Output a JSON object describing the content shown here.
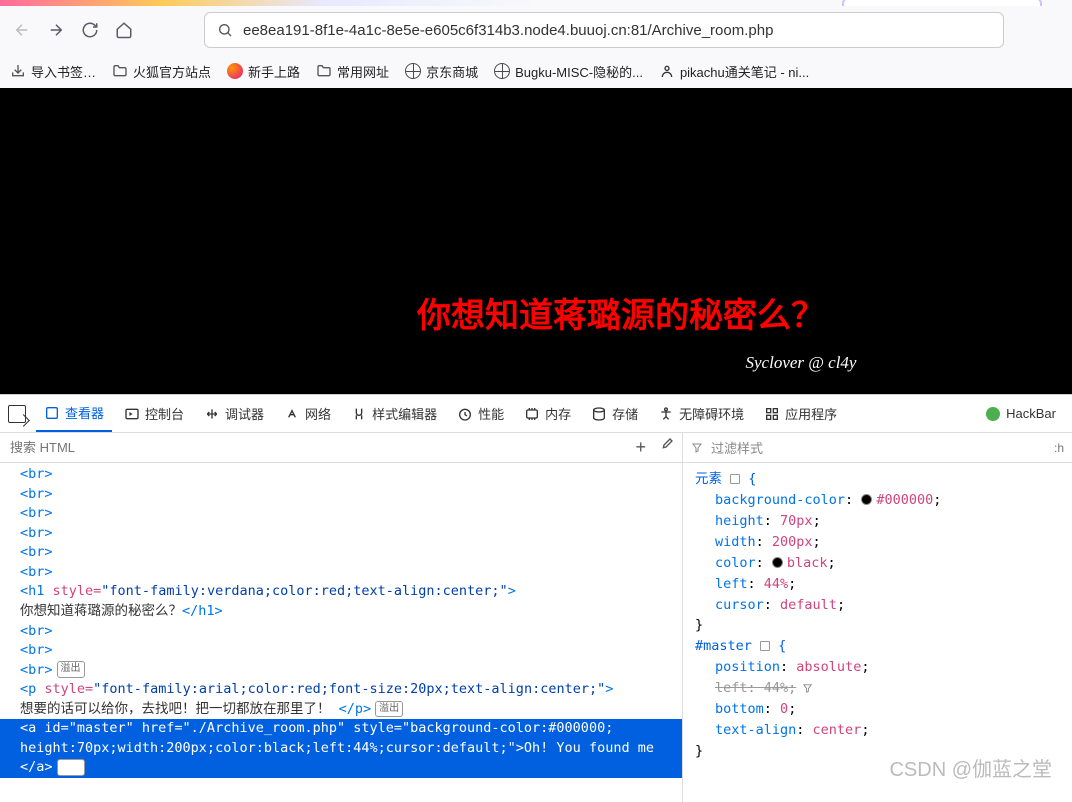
{
  "nav": {
    "url": "ee8ea191-8f1e-4a1c-8e5e-e605c6f314b3.node4.buuoj.cn:81/Archive_room.php"
  },
  "bookmarks": {
    "import": "导入书签…",
    "items": [
      {
        "label": "火狐官方站点",
        "icon": "folder"
      },
      {
        "label": "新手上路",
        "icon": "firefox"
      },
      {
        "label": "常用网址",
        "icon": "folder"
      },
      {
        "label": "京东商城",
        "icon": "globe"
      },
      {
        "label": "Bugku-MISC-隐秘的...",
        "icon": "globe"
      },
      {
        "label": "pikachu通关笔记 - ni...",
        "icon": "person"
      }
    ]
  },
  "page": {
    "headline": "你想知道蒋璐源的秘密么？",
    "signature": "Syclover @ cl4y"
  },
  "devtools": {
    "tabs": [
      "查看器",
      "控制台",
      "调试器",
      "网络",
      "样式编辑器",
      "性能",
      "内存",
      "存储",
      "无障碍环境",
      "应用程序"
    ],
    "hackbar": "HackBar",
    "search_ph": "搜索 HTML",
    "plus": "+",
    "dropper": "🖉",
    "filter_ph": "过滤样式",
    "hov": ":h",
    "badge": "溢出"
  },
  "markup": {
    "br": "<br>",
    "h1_open": "<h1 ",
    "h1_style_k": "style",
    "h1_style_v": "\"font-family:verdana;color:red;text-align:center;\"",
    "h1_close": ">",
    "h1_text": "你想知道蒋璐源的秘密么？",
    "h1_end": "</h1>",
    "p_open": "<p ",
    "p_style_v": "\"font-family:arial;color:red;font-size:20px;text-align:center;\"",
    "p_close": ">",
    "p_text": "想要的话可以给你，去找吧！把一切都放在那里了！",
    "p_end": "</p>",
    "a_line1": "<a id=\"master\" href=\"./Archive_room.php\" style=\"background-color:#000000;",
    "a_line2": "height:70px;width:200px;color:black;left:44%;cursor:default;\">Oh! You found me",
    "a_line3": "</a>"
  },
  "styles": {
    "r1": {
      "sel": "元素",
      "decl": [
        {
          "p": "background-color",
          "v": "#000000",
          "sw": "#000"
        },
        {
          "p": "height",
          "v": "70px"
        },
        {
          "p": "width",
          "v": "200px"
        },
        {
          "p": "color",
          "v": "black",
          "sw": "#000"
        },
        {
          "p": "left",
          "v": "44%"
        },
        {
          "p": "cursor",
          "v": "default"
        }
      ]
    },
    "r2": {
      "sel": "#master",
      "decl": [
        {
          "p": "position",
          "v": "absolute"
        },
        {
          "p": "left",
          "v": "44%",
          "struck": true,
          "funnel": true
        },
        {
          "p": "bottom",
          "v": "0"
        },
        {
          "p": "text-align",
          "v": "center"
        }
      ]
    }
  },
  "watermark": "CSDN @伽蓝之堂"
}
